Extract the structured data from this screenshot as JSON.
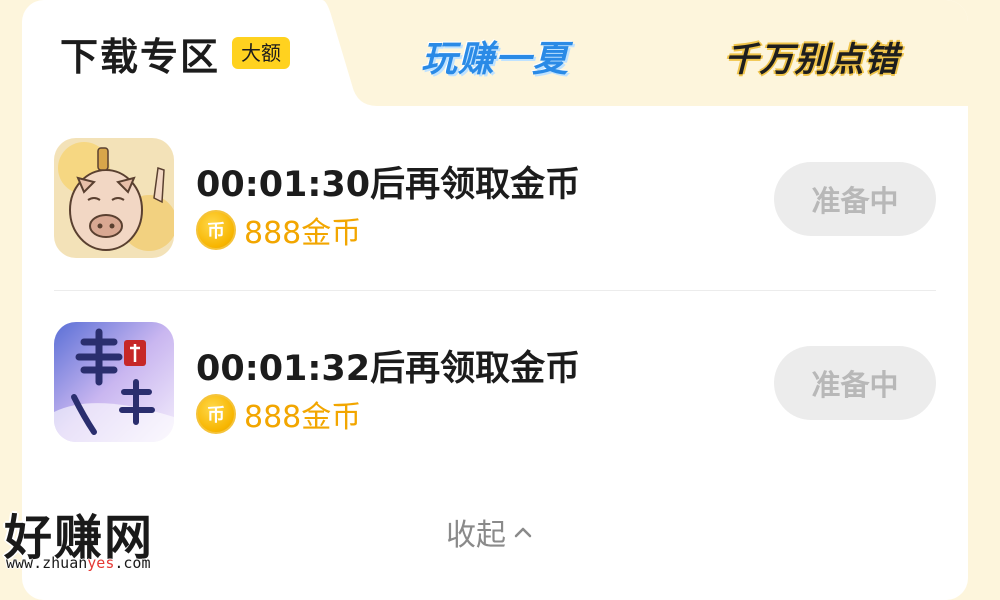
{
  "tabs": {
    "active": {
      "label": "下载专区",
      "badge": "大额"
    },
    "promo_1": "玩赚一夏",
    "promo_2": "千万别点错"
  },
  "tasks": [
    {
      "app_icon": "pig-character-game-icon",
      "title": "00:01:30后再领取金币",
      "coin_glyph": "币",
      "reward": "888金币",
      "button": "准备中"
    },
    {
      "app_icon": "qingyun-jue-game-icon",
      "title": "00:01:32后再领取金币",
      "coin_glyph": "币",
      "reward": "888金币",
      "button": "准备中"
    }
  ],
  "collapse_label": "收起",
  "watermark": {
    "brand": "好赚网",
    "url_pre": "www.zhuan",
    "url_hl": "yes",
    "url_post": ".com"
  },
  "colors": {
    "accent_yellow": "#ffd21f",
    "coin_gold": "#f2a600",
    "tab_bg": "#fdf5dc"
  }
}
